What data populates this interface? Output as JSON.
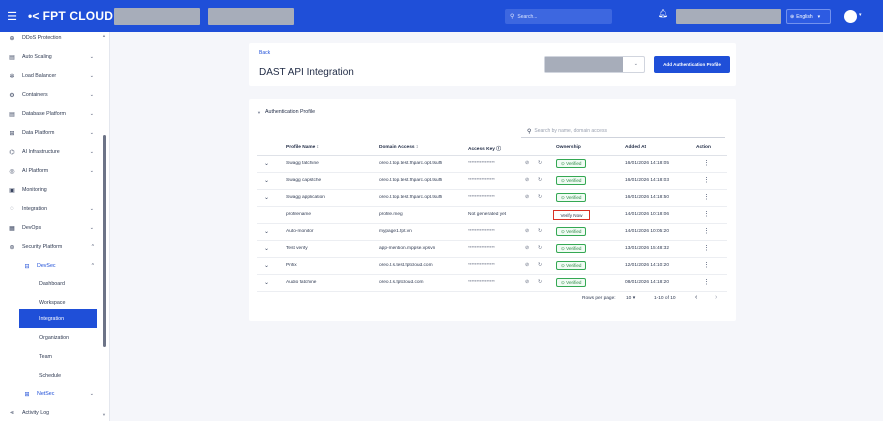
{
  "topbar": {
    "menu_icon": "hamburger-icon",
    "logo_mark": "•<",
    "logo_text": "FPT CLOUD",
    "search_placeholder": "Search...",
    "language": "English"
  },
  "sidebar": {
    "items": [
      {
        "label": "DDoS Protection",
        "icon": "shield-icon",
        "glyph": "⊕",
        "chevron": false
      },
      {
        "label": "Auto Scaling",
        "icon": "scaling-icon",
        "glyph": "▤",
        "chevron": true
      },
      {
        "label": "Load Balancer",
        "icon": "load-balancer-icon",
        "glyph": "✲",
        "chevron": true
      },
      {
        "label": "Containers",
        "icon": "containers-icon",
        "glyph": "⚙",
        "chevron": true
      },
      {
        "label": "Database Platform",
        "icon": "database-icon",
        "glyph": "▤",
        "chevron": true
      },
      {
        "label": "Data Platform",
        "icon": "data-platform-icon",
        "glyph": "⊞",
        "chevron": true
      },
      {
        "label": "AI Infrastructure",
        "icon": "ai-infrastructure-icon",
        "glyph": "⌬",
        "chevron": true
      },
      {
        "label": "AI Platform",
        "icon": "ai-platform-icon",
        "glyph": "◎",
        "chevron": true
      },
      {
        "label": "Monitoring",
        "icon": "monitoring-icon",
        "glyph": "▣",
        "chevron": false
      },
      {
        "label": "Integration",
        "icon": "integration-icon",
        "glyph": "◌",
        "chevron": true
      },
      {
        "label": "DevOps",
        "icon": "devops-icon",
        "glyph": "▦",
        "chevron": true
      },
      {
        "label": "Security Platform",
        "icon": "security-platform-icon",
        "glyph": "⊛",
        "chevron_up": true
      }
    ],
    "devsec": {
      "label": "DevSec",
      "chev": "^"
    },
    "devsec_children": [
      "Dashboard",
      "Workspace",
      "Integration",
      "Organization",
      "Team",
      "Schedule"
    ],
    "netsec": {
      "label": "NetSec"
    },
    "activity_log": {
      "label": "Activity Log"
    }
  },
  "header": {
    "back_label": "Back",
    "title": "DAST API Integration",
    "add_button": "Add Authentication Profile"
  },
  "section": {
    "title": "Authentication Profile",
    "search_placeholder": "Search by name, domain access"
  },
  "table": {
    "columns": [
      "Profile Name ↕",
      "Domain Access ↕",
      "Access Key ⓘ",
      "Ownership",
      "Added At",
      "Action"
    ],
    "rows": [
      {
        "name": "Swagg fatchine",
        "domain": "oreo.t.top.test.fhparc.opt.tsuffi",
        "key": "****************",
        "status": "Verified",
        "added": "16/01/2026 14:18:05",
        "expand": true
      },
      {
        "name": "Swagg capstche",
        "domain": "oreo.t.top.test.fhparc.opt.tsuffi",
        "key": "****************",
        "status": "Verified",
        "added": "16/01/2026 14:18:03",
        "expand": true
      },
      {
        "name": "Swagg application",
        "domain": "oreo.t.top.test.fhparc.opt.tsuffi",
        "key": "****************",
        "status": "Verified",
        "added": "16/01/2026 14:18:50",
        "expand": true
      },
      {
        "name": "profilename",
        "domain": "profile.meg",
        "key": "Not generated yet",
        "status": "Verify Now",
        "added": "14/01/2026 10:18:06",
        "expand": false
      },
      {
        "name": "Auto-monitor",
        "domain": "mypage1.fpt.vn",
        "key": "****************",
        "status": "Verified",
        "added": "14/01/2026 10:05:20",
        "expand": true
      },
      {
        "name": "Test verify",
        "domain": "app-mention.mppse.vpsvn",
        "key": "****************",
        "status": "Verified",
        "added": "13/01/2026 15:48:32",
        "expand": true
      },
      {
        "name": "Prifix",
        "domain": "oreo.t.s.test.fptcloud.com",
        "key": "****************",
        "status": "Verified",
        "added": "12/01/2026 14:10:20",
        "expand": true
      },
      {
        "name": "Audio fatchine",
        "domain": "oreo.t.s.fptcloud.com",
        "key": "****************",
        "status": "Verified",
        "added": "08/01/2026 14:18:20",
        "expand": true
      }
    ]
  },
  "pagination": {
    "rows_per_page_label": "Rows per page:",
    "rows_per_page_value": "10",
    "range": "1-10 of 10",
    "prev": "‹",
    "next": "›"
  }
}
